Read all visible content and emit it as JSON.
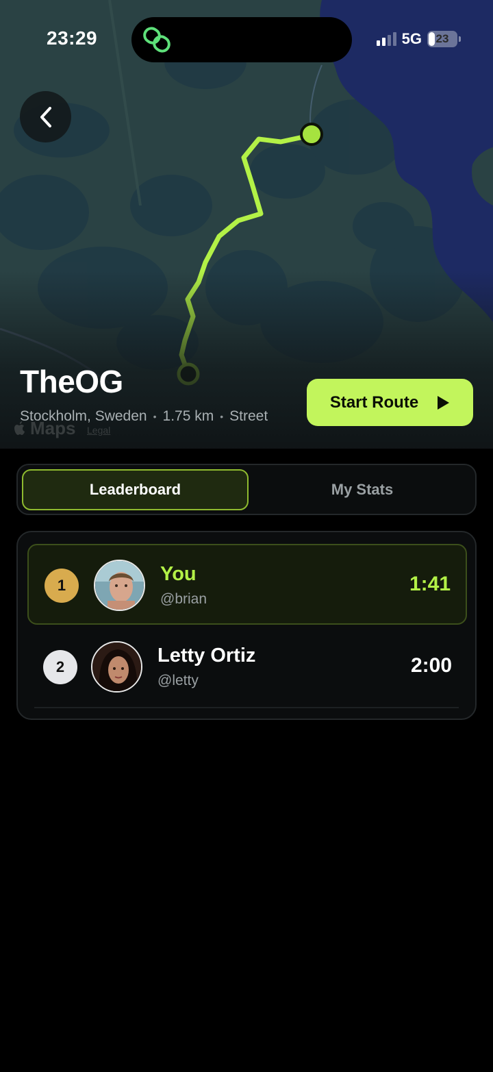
{
  "status_bar": {
    "time": "23:29",
    "network": "5G",
    "battery": "23",
    "battery_level": 0.23
  },
  "route": {
    "name": "TheOG",
    "location": "Stockholm, Sweden",
    "distance": "1.75 km",
    "type": "Street"
  },
  "map": {
    "attribution": "Maps",
    "legal": "Legal"
  },
  "actions": {
    "start_route": "Start Route"
  },
  "tabs": [
    {
      "label": "Leaderboard",
      "active": true
    },
    {
      "label": "My Stats",
      "active": false
    }
  ],
  "leaderboard": [
    {
      "rank": "1",
      "name": "You",
      "handle": "@brian",
      "time": "1:41",
      "is_me": true
    },
    {
      "rank": "2",
      "name": "Letty Ortiz",
      "handle": "@letty",
      "time": "2:00",
      "is_me": false
    }
  ],
  "colors": {
    "accent": "#c2f55c",
    "gold": "#d8ab4e",
    "silver": "#e6e7ea",
    "water": "#1d2a63"
  },
  "icons": {
    "back": "chevron-left-icon",
    "play": "play-icon",
    "app": "link-chain-icon"
  }
}
